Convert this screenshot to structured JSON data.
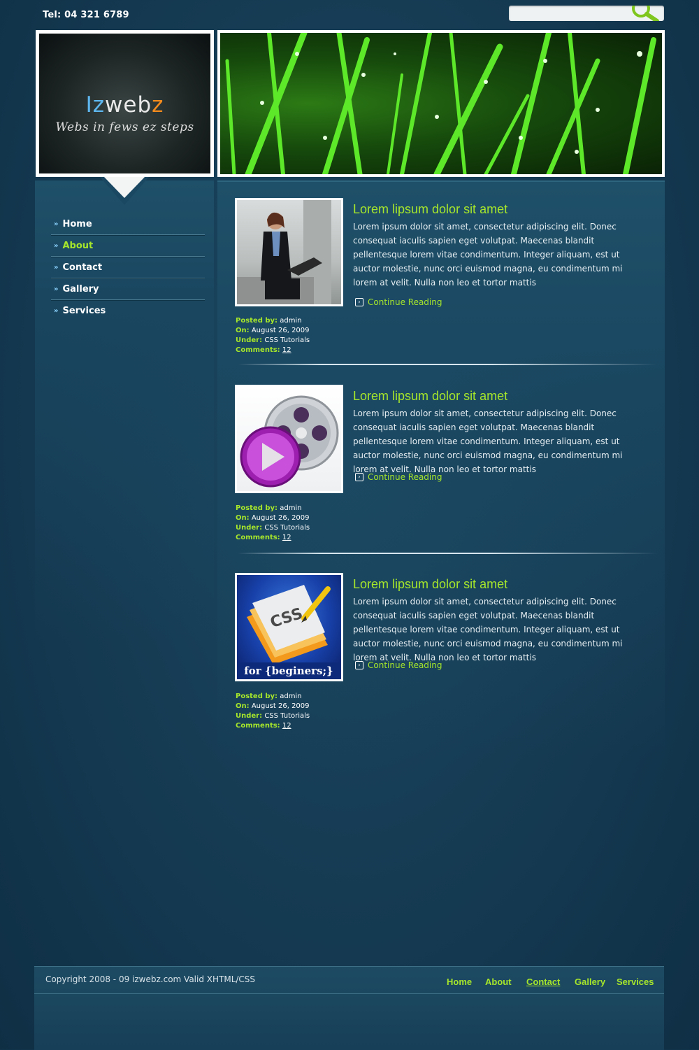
{
  "header": {
    "tel": "Tel: 04 321 6789",
    "search_placeholder": "",
    "logo": {
      "part1": "Iz",
      "part2": "web",
      "part3": "z",
      "tagline": "Webs in fews ez steps"
    }
  },
  "sidebar": {
    "items": [
      {
        "label": "Home"
      },
      {
        "label": "About",
        "active": true
      },
      {
        "label": "Contact"
      },
      {
        "label": "Gallery"
      },
      {
        "label": "Services"
      }
    ]
  },
  "posts": [
    {
      "title": "Lorem lipsum dolor sit amet",
      "body": "Lorem ipsum dolor sit amet, consectetur adipiscing elit. Donec consequat iaculis sapien eget volutpat. Maecenas blandit pellentesque lorem vitae condimentum. Integer aliquam, est ut auctor molestie, nunc orci euismod magna, eu condimentum mi lorem at velit. Nulla non leo et tortor mattis",
      "more": "Continue Reading",
      "image": "businesswoman-laptop",
      "meta": {
        "posted_by_label": "Posted by:",
        "posted_by": "admin",
        "on_label": "On:",
        "on": "August 26, 2009",
        "under_label": "Under:",
        "under": "CSS Tutorials",
        "comments_label": "Comments:",
        "comments": "12"
      }
    },
    {
      "title": "Lorem lipsum dolor sit amet",
      "body": "Lorem ipsum dolor sit amet, consectetur adipiscing elit. Donec consequat iaculis sapien eget volutpat. Maecenas blandit pellentesque lorem vitae condimentum. Integer aliquam, est ut auctor molestie, nunc orci euismod magna, eu condimentum mi lorem at velit. Nulla non leo et tortor mattis",
      "more": "Continue Reading",
      "image": "film-reel-play",
      "meta": {
        "posted_by_label": "Posted by:",
        "posted_by": "admin",
        "on_label": "On:",
        "on": "August 26, 2009",
        "under_label": "Under:",
        "under": "CSS Tutorials",
        "comments_label": "Comments:",
        "comments": "12"
      }
    },
    {
      "title": "Lorem lipsum dolor sit amet",
      "body": "Lorem ipsum dolor sit amet, consectetur adipiscing elit. Donec consequat iaculis sapien eget volutpat. Maecenas blandit pellentesque lorem vitae condimentum. Integer aliquam, est ut auctor molestie, nunc orci euismod magna, eu condimentum mi lorem at velit. Nulla non leo et tortor mattis",
      "more": "Continue Reading",
      "image": "css-for-beginers",
      "image_text": {
        "css": "CSS",
        "caption": "for {beginers;}"
      },
      "meta": {
        "posted_by_label": "Posted by:",
        "posted_by": "admin",
        "on_label": "On:",
        "on": "August 26, 2009",
        "under_label": "Under:",
        "under": "CSS Tutorials",
        "comments_label": "Comments:",
        "comments": "12"
      }
    }
  ],
  "footer": {
    "copyright": "Copyright 2008 - 09 izwebz.com Valid XHTML/CSS",
    "nav": [
      {
        "label": "Home"
      },
      {
        "label": "About"
      },
      {
        "label": "Contact",
        "active": true
      },
      {
        "label": "Gallery"
      },
      {
        "label": "Services"
      }
    ]
  },
  "colors": {
    "accent": "#a6e62b",
    "background": "#163d55"
  }
}
